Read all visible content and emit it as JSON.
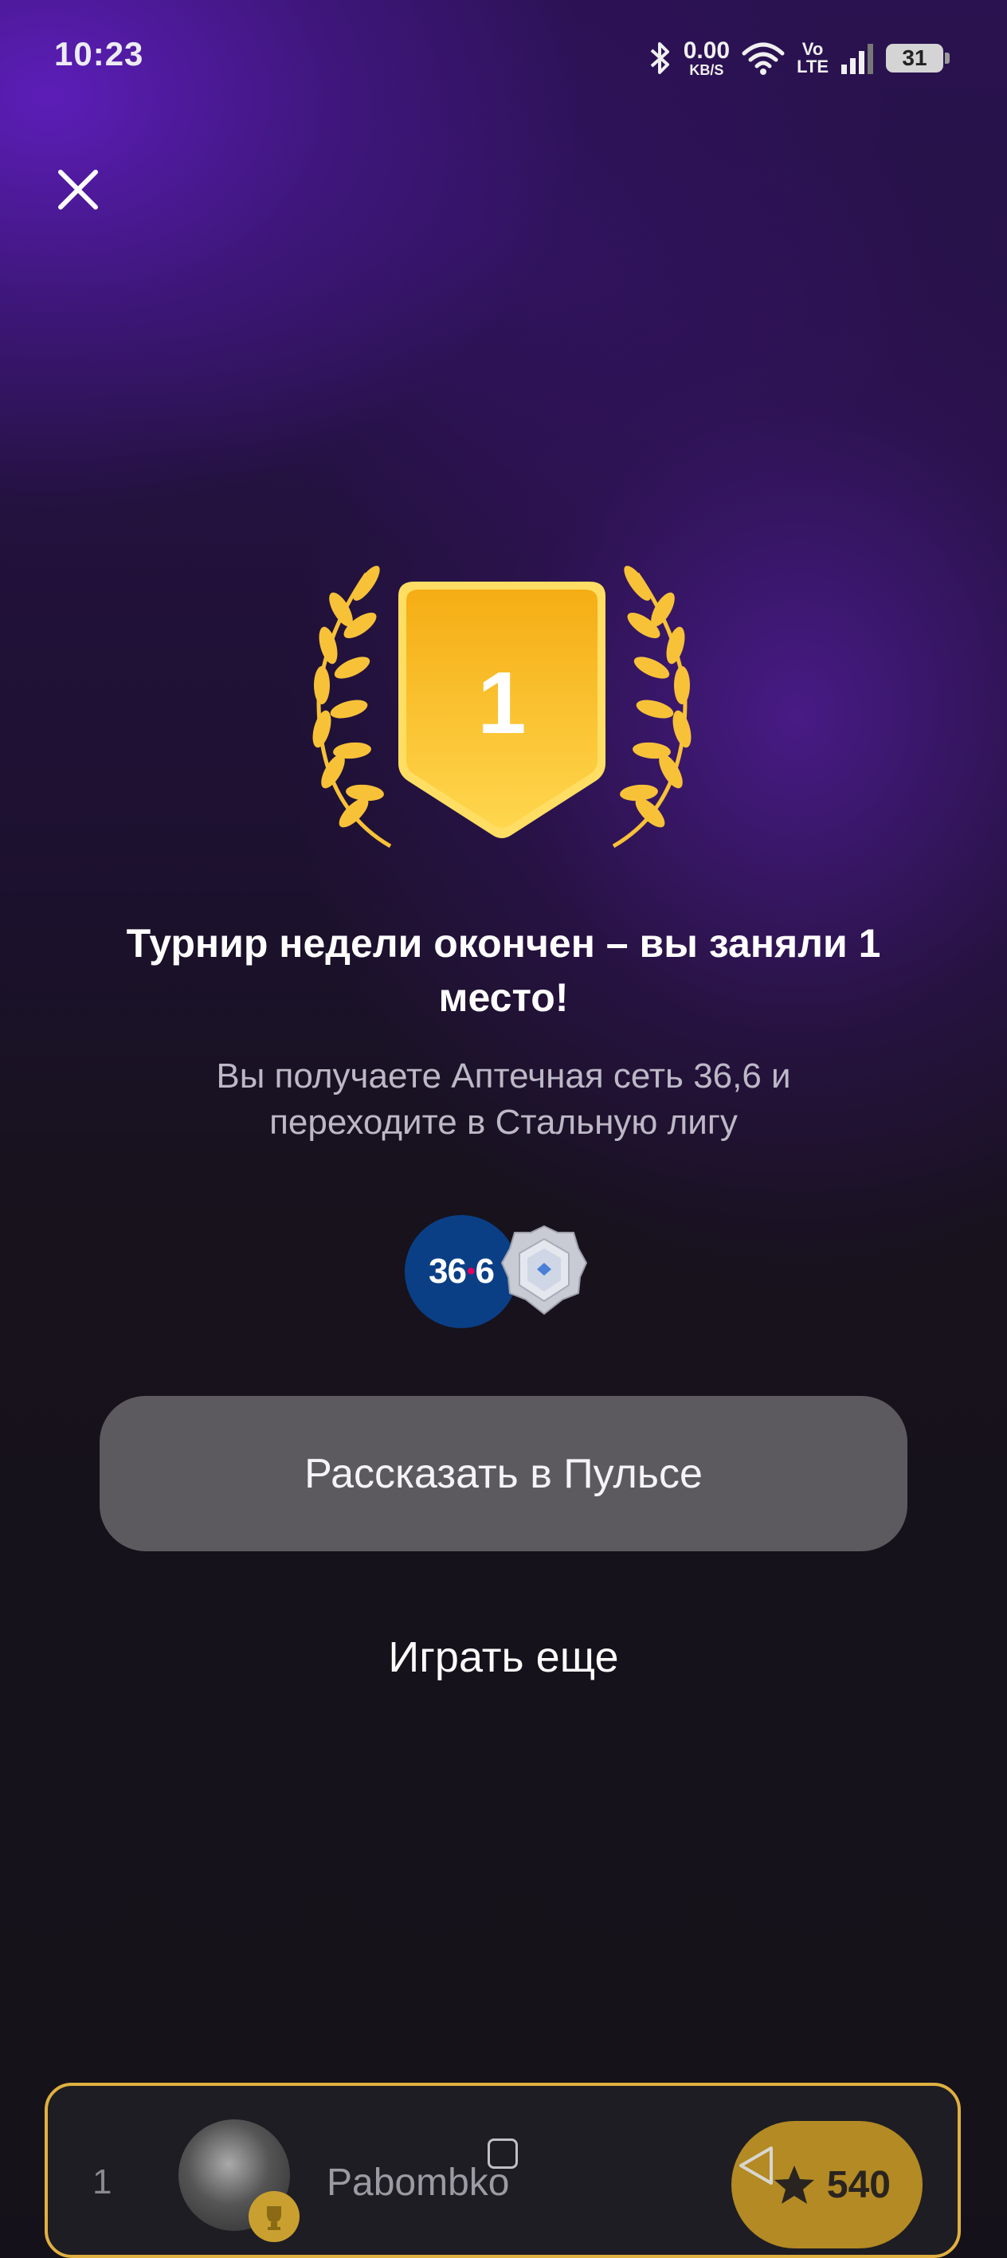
{
  "status_bar": {
    "time": "10:23",
    "net_speed_value": "0.00",
    "net_speed_unit": "KB/S",
    "volte_top": "Vo",
    "volte_bottom": "LTE",
    "battery_level": "31",
    "icons": [
      "bluetooth-icon",
      "wifi-icon",
      "signal-icon",
      "battery-icon"
    ]
  },
  "header": {
    "close_icon": "close-icon"
  },
  "trophy": {
    "place": "1",
    "colors": {
      "gold_light": "#ffd54a",
      "gold_dark": "#f2a91a",
      "laurel": "#f7c238"
    }
  },
  "result": {
    "headline": "Турнир недели окончен – вы заняли 1 место!",
    "subtext": "Вы получаете Аптечная сеть 36,6 и переходите в Стальную лигу"
  },
  "rewards": {
    "pharmacy_logo_text_a": "36",
    "pharmacy_logo_dot": "•",
    "pharmacy_logo_text_b": "6",
    "league_badge_icon": "steel-league-badge-icon"
  },
  "actions": {
    "share_label": "Рассказать в Пульсе",
    "play_again_label": "Играть еще"
  },
  "leaderboard_row": {
    "rank": "1",
    "name": "Рabombko",
    "score": "540",
    "score_icon": "star-icon"
  },
  "colors": {
    "button_bg": "#5c5a5f",
    "card_border": "#e0b040",
    "score_bg": "#b38a23"
  }
}
